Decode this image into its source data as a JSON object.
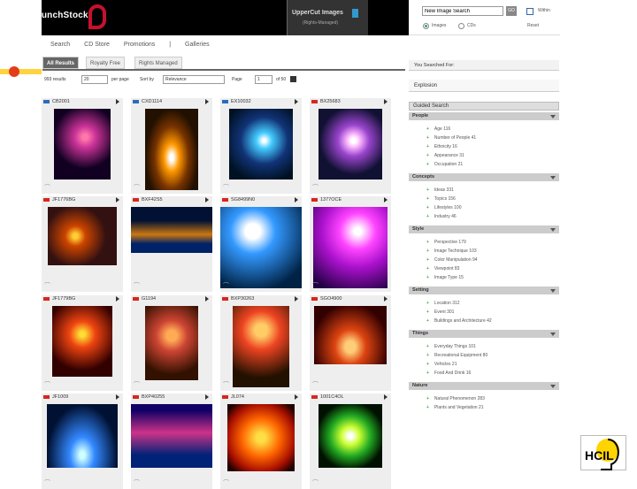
{
  "header": {
    "logo": "PunchStock",
    "brand_title": "UpperCut Images",
    "brand_sub": "(Rights-Managed)",
    "search_value": "New Image Search",
    "go_label": "GO",
    "checkbox_label": "Within",
    "radio_images": "Images",
    "radio_cds": "CDs",
    "help_label": "Reset"
  },
  "nav": [
    "Search",
    "CD Store",
    "Promotions",
    "|",
    "Galleries"
  ],
  "tabs": [
    "All Results",
    "Royalty Free",
    "Rights Managed"
  ],
  "controls": {
    "results_label": "993 results",
    "per_page": "20",
    "per_page_label": "per page",
    "sort_label": "Sort by",
    "sort_value": "Relevance",
    "page_label": "Page",
    "page_value": "1",
    "of_label": "of 50"
  },
  "grid": [
    {
      "id": "CB2001",
      "flag": "blue"
    },
    {
      "id": "CXD1114",
      "flag": "blue"
    },
    {
      "id": "EX10032",
      "flag": "blue"
    },
    {
      "id": "BX25683",
      "flag": "red"
    },
    {
      "id": "JF1776BG",
      "flag": "red"
    },
    {
      "id": "BXF42S5",
      "flag": "red"
    },
    {
      "id": "SG8499N0",
      "flag": "red"
    },
    {
      "id": "1377OCE",
      "flag": "red"
    },
    {
      "id": "JF1779BG",
      "flag": "red"
    },
    {
      "id": "G1194",
      "flag": "red"
    },
    {
      "id": "BXP30263",
      "flag": "red"
    },
    {
      "id": "SGO4900",
      "flag": "red"
    },
    {
      "id": "JF1009",
      "flag": "red"
    },
    {
      "id": "BXP40255",
      "flag": "red"
    },
    {
      "id": "JL074",
      "flag": "red"
    },
    {
      "id": "1001C4OL",
      "flag": "red"
    }
  ],
  "sidebar": {
    "searched_for": "You Searched For:",
    "query": "Explosion",
    "guided_search": "Guided Search",
    "sections": [
      {
        "title": "People",
        "items": [
          "Age 116",
          "Number of People 41",
          "Ethnicity 16",
          "Appearance 31",
          "Occupation 21"
        ]
      },
      {
        "title": "Concepts",
        "items": [
          "Ideas 331",
          "Topics 156",
          "Lifestyles 100",
          "Industry 46"
        ]
      },
      {
        "title": "Style",
        "items": [
          "Perspective 179",
          "Image Technique 103",
          "Color Manipulation 94",
          "Viewpoint 83",
          "Image Type 15"
        ]
      },
      {
        "title": "Setting",
        "items": [
          "Location 312",
          "Event 301",
          "Buildings and Architecture 42"
        ]
      },
      {
        "title": "Things",
        "items": [
          "Everyday Things 101",
          "Recreational Equipment 80",
          "Vehicles 21",
          "Food And Drink 16"
        ]
      },
      {
        "title": "Nature",
        "items": [
          "Natural Phenomenon 283",
          "Plants and Vegetation 21"
        ]
      }
    ]
  },
  "footer_logo": "HCIL"
}
